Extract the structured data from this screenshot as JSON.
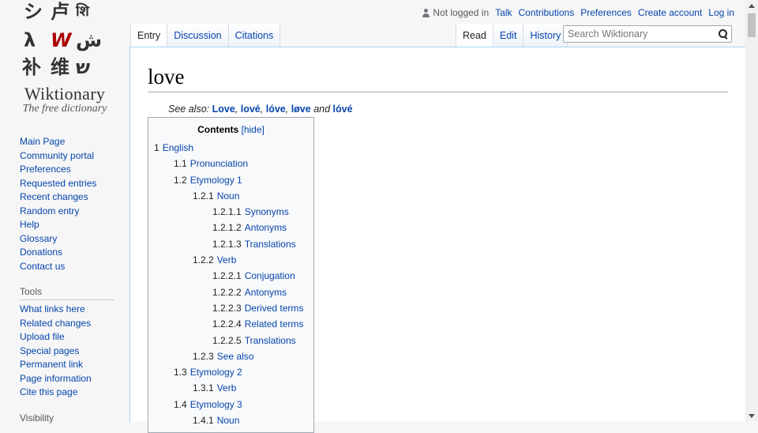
{
  "logo": {
    "glyphs": [
      "シ",
      "卢",
      "शि",
      "λ",
      "W",
      "ش",
      "补",
      "维",
      "ש"
    ],
    "wordmark": "Wiktionary",
    "tagline": "The free dictionary"
  },
  "sidebar": {
    "navigation": [
      "Main Page",
      "Community portal",
      "Preferences",
      "Requested entries",
      "Recent changes",
      "Random entry",
      "Help",
      "Glossary",
      "Donations",
      "Contact us"
    ],
    "tools": {
      "heading": "Tools",
      "items": [
        "What links here",
        "Related changes",
        "Upload file",
        "Special pages",
        "Permanent link",
        "Page information",
        "Cite this page"
      ]
    },
    "visibility": {
      "heading": "Visibility"
    }
  },
  "personal": {
    "not_logged_in": "Not logged in",
    "talk": "Talk",
    "contributions": "Contributions",
    "preferences": "Preferences",
    "create_account": "Create account",
    "log_in": "Log in"
  },
  "tabs": {
    "entry": "Entry",
    "discussion": "Discussion",
    "citations": "Citations",
    "read": "Read",
    "edit": "Edit",
    "history": "History"
  },
  "search": {
    "placeholder": "Search Wiktionary",
    "value": ""
  },
  "page": {
    "title": "love",
    "see_also_prefix": "See also:",
    "see_also": [
      "Love",
      "lové",
      "lóve",
      "løve",
      "lóvé"
    ],
    "see_also_and": "and"
  },
  "toc": {
    "title": "Contents",
    "hide": "[hide]",
    "items": [
      {
        "num": "1",
        "label": "English",
        "level": 1
      },
      {
        "num": "1.1",
        "label": "Pronunciation",
        "level": 2
      },
      {
        "num": "1.2",
        "label": "Etymology 1",
        "level": 2
      },
      {
        "num": "1.2.1",
        "label": "Noun",
        "level": 3
      },
      {
        "num": "1.2.1.1",
        "label": "Synonyms",
        "level": 4
      },
      {
        "num": "1.2.1.2",
        "label": "Antonyms",
        "level": 4
      },
      {
        "num": "1.2.1.3",
        "label": "Translations",
        "level": 4
      },
      {
        "num": "1.2.2",
        "label": "Verb",
        "level": 3
      },
      {
        "num": "1.2.2.1",
        "label": "Conjugation",
        "level": 4
      },
      {
        "num": "1.2.2.2",
        "label": "Antonyms",
        "level": 4
      },
      {
        "num": "1.2.2.3",
        "label": "Derived terms",
        "level": 4
      },
      {
        "num": "1.2.2.4",
        "label": "Related terms",
        "level": 4
      },
      {
        "num": "1.2.2.5",
        "label": "Translations",
        "level": 4
      },
      {
        "num": "1.2.3",
        "label": "See also",
        "level": 3
      },
      {
        "num": "1.3",
        "label": "Etymology 2",
        "level": 2
      },
      {
        "num": "1.3.1",
        "label": "Verb",
        "level": 3
      },
      {
        "num": "1.4",
        "label": "Etymology 3",
        "level": 2
      },
      {
        "num": "1.4.1",
        "label": "Noun",
        "level": 3
      }
    ]
  },
  "colors": {
    "link": "#0645ad",
    "border": "#a7d7f9"
  }
}
